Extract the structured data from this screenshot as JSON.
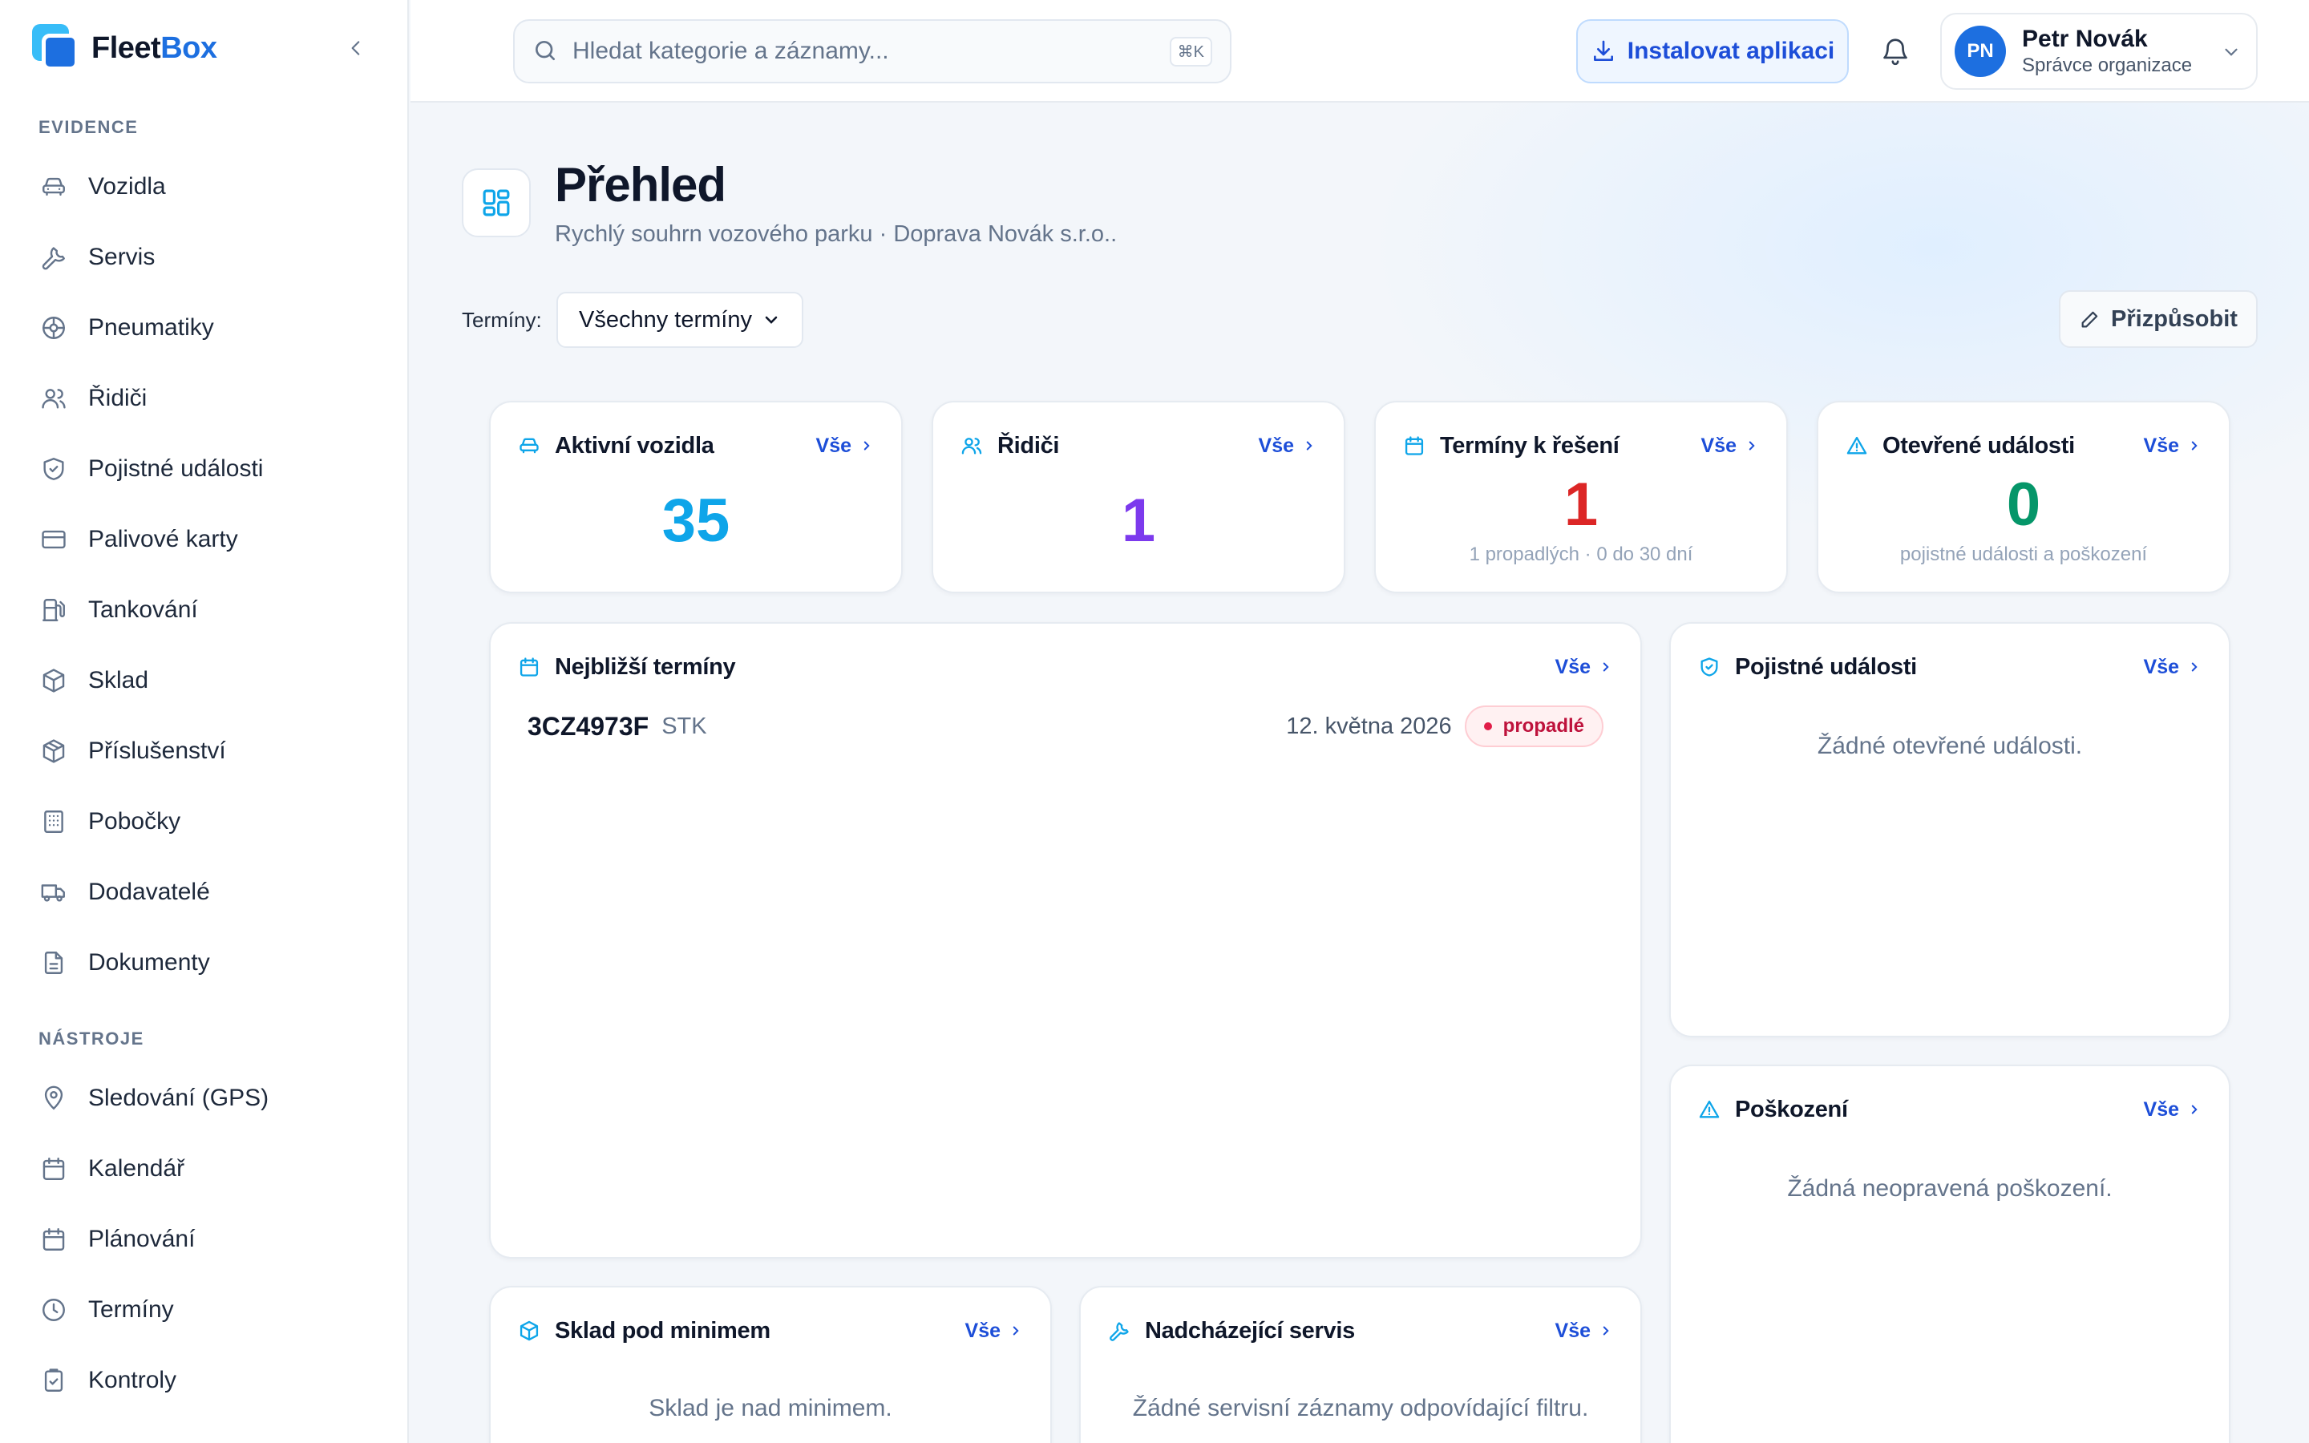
{
  "brand": {
    "name_part1": "Fleet",
    "name_part2": "Box"
  },
  "sidebar": {
    "section_evidence": "EVIDENCE",
    "section_tools": "NÁSTROJE",
    "evidence_items": [
      {
        "label": "Vozidla",
        "icon": "car-icon"
      },
      {
        "label": "Servis",
        "icon": "wrench-icon"
      },
      {
        "label": "Pneumatiky",
        "icon": "tire-icon"
      },
      {
        "label": "Řidiči",
        "icon": "users-icon"
      },
      {
        "label": "Pojistné události",
        "icon": "shield-icon"
      },
      {
        "label": "Palivové karty",
        "icon": "credit-card-icon"
      },
      {
        "label": "Tankování",
        "icon": "fuel-icon"
      },
      {
        "label": "Sklad",
        "icon": "box-icon"
      },
      {
        "label": "Příslušenství",
        "icon": "package-icon"
      },
      {
        "label": "Pobočky",
        "icon": "building-icon"
      },
      {
        "label": "Dodavatelé",
        "icon": "truck-icon"
      },
      {
        "label": "Dokumenty",
        "icon": "document-icon"
      }
    ],
    "tool_items": [
      {
        "label": "Sledování (GPS)",
        "icon": "map-pin-icon"
      },
      {
        "label": "Kalendář",
        "icon": "calendar-icon"
      },
      {
        "label": "Plánování",
        "icon": "calendar-plan-icon"
      },
      {
        "label": "Termíny",
        "icon": "clock-icon"
      },
      {
        "label": "Kontroly",
        "icon": "clipboard-check-icon"
      }
    ]
  },
  "topbar": {
    "search_placeholder": "Hledat kategorie a záznamy...",
    "search_shortcut": "⌘K",
    "install_label": "Instalovat aplikaci",
    "user": {
      "initials": "PN",
      "name": "Petr Novák",
      "role": "Správce organizace"
    }
  },
  "page": {
    "title": "Přehled",
    "subtitle": "Rychlý souhrn vozového parku · Doprava Novák s.r.o..",
    "filter_label": "Termíny:",
    "filter_value": "Všechny termíny",
    "customize_label": "Přizpůsobit"
  },
  "colors": {
    "accent": "#1d4ed8",
    "active_vehicles": "#0ea5e9",
    "drivers": "#7c3aed",
    "terms": "#dc2626",
    "events": "#059669"
  },
  "stats": [
    {
      "title": "Aktivní vozidla",
      "all": "Vše",
      "value": "35",
      "note": ""
    },
    {
      "title": "Řidiči",
      "all": "Vše",
      "value": "1",
      "note": ""
    },
    {
      "title": "Termíny k řešení",
      "all": "Vše",
      "value": "1",
      "note": "1 propadlých · 0 do 30 dní"
    },
    {
      "title": "Otevřené události",
      "all": "Vše",
      "value": "0",
      "note": "pojistné události a poškození"
    }
  ],
  "upcoming": {
    "title": "Nejbližší termíny",
    "all": "Vše",
    "rows": [
      {
        "plate": "3CZ4973F",
        "type": "STK",
        "date": "12. května 2026",
        "status": "propadlé"
      }
    ]
  },
  "insurance": {
    "title": "Pojistné události",
    "all": "Vše",
    "empty": "Žádné otevřené události."
  },
  "damage": {
    "title": "Poškození",
    "all": "Vše",
    "empty": "Žádná neopravená poškození."
  },
  "stock": {
    "title": "Sklad pod minimem",
    "all": "Vše",
    "empty": "Sklad je nad minimem."
  },
  "service": {
    "title": "Nadcházející servis",
    "all": "Vše",
    "empty": "Žádné servisní záznamy odpovídající filtru."
  }
}
